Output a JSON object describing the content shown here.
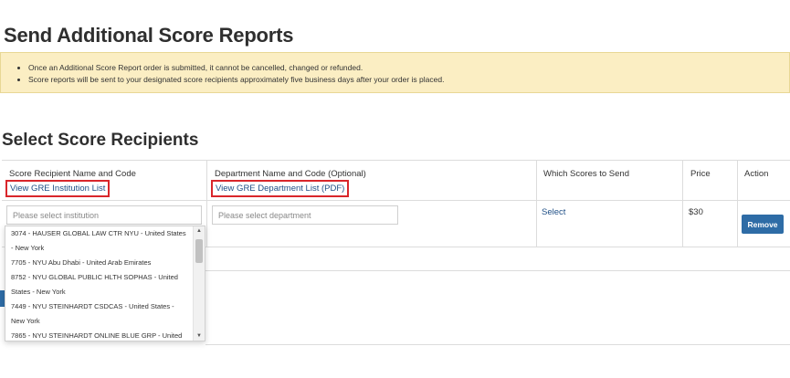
{
  "page_title": "Send Additional Score Reports",
  "notice": {
    "items": [
      "Once an Additional Score Report order is submitted, it cannot be cancelled, changed or refunded.",
      "Score reports will be sent to your designated score recipients approximately five business days after your order is placed."
    ]
  },
  "section_title": "Select Score Recipients",
  "table": {
    "headers": {
      "recipient": "Score Recipient Name and Code",
      "department": "Department Name and Code (Optional)",
      "scores": "Which Scores to Send",
      "price": "Price",
      "action": "Action"
    },
    "links": {
      "institution_list": "View GRE Institution List",
      "department_list": "View GRE Department List (PDF)"
    },
    "row": {
      "institution_placeholder": "Please select institution",
      "department_placeholder": "Please select department",
      "scores_link": "Select",
      "price": "$30",
      "remove_label": "Remove"
    }
  },
  "dropdown": {
    "items": [
      "3074 - HAUSER GLOBAL LAW CTR NYU - United States - New York",
      "7705 - NYU Abu Dhabi - United Arab Emirates",
      "8752 - NYU GLOBAL PUBLIC HLTH SOPHAS - United States - New York",
      "7449 - NYU STEINHARDT CSDCAS - United States - New York",
      "7865 - NYU STEINHARDT ONLINE BLUE GRP - United"
    ]
  },
  "colors": {
    "notice_bg": "#fbeec3",
    "link": "#1f4f86",
    "highlight_box": "#d9262b",
    "button": "#2e6ca6"
  }
}
